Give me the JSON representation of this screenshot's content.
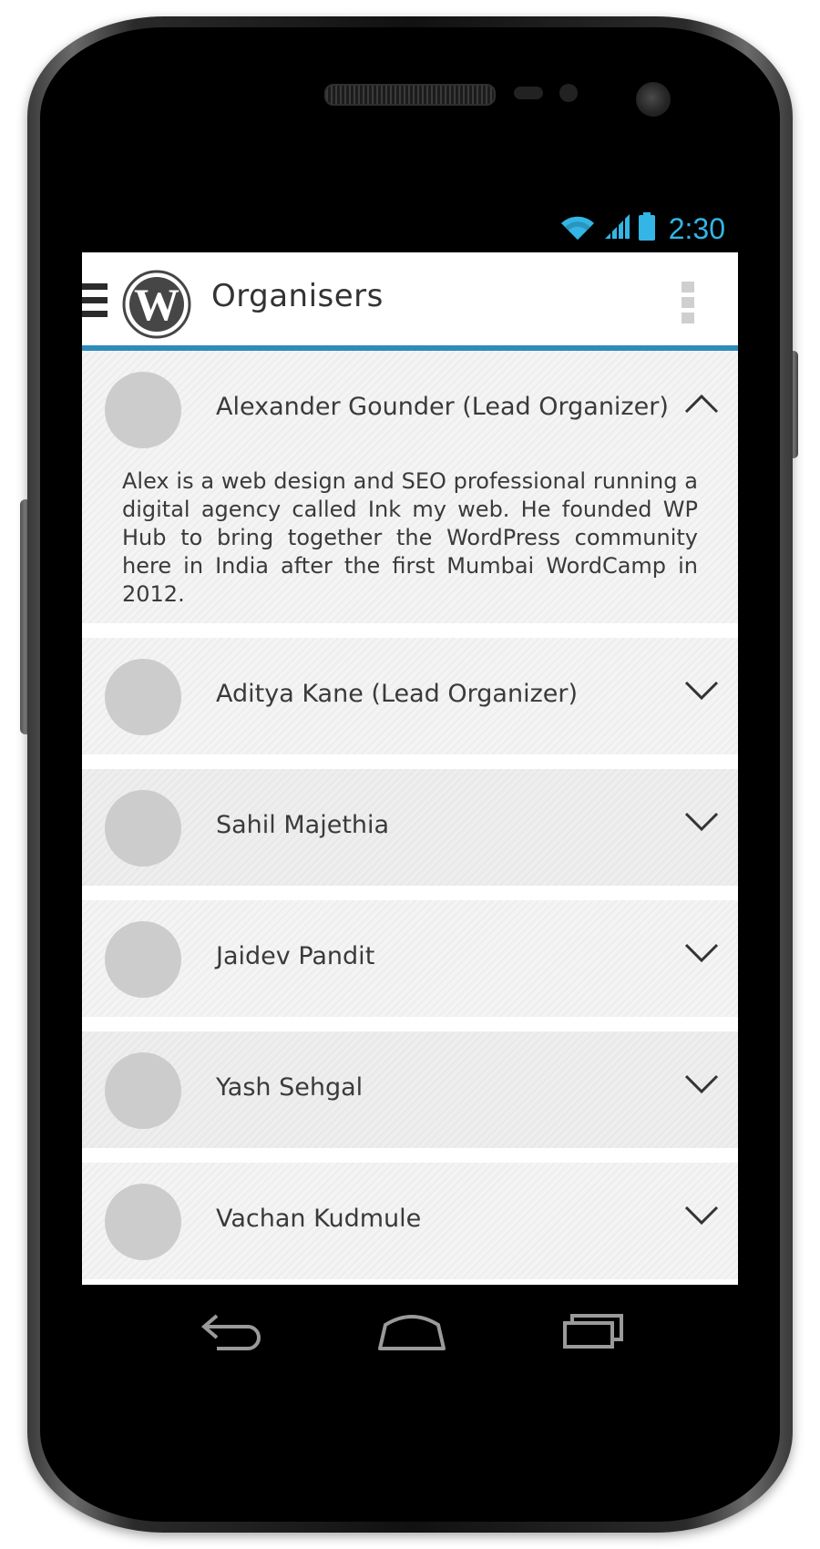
{
  "status_bar": {
    "time": "2:30",
    "icons": [
      "wifi-icon",
      "signal-icon",
      "battery-icon"
    ],
    "accent_color": "#33b5e5"
  },
  "action_bar": {
    "title": "Organisers",
    "logo": "wordpress-logo",
    "menu_icon": "hamburger-menu-icon",
    "overflow_icon": "overflow-menu-icon",
    "divider_color": "#2d8cbd"
  },
  "organizers": [
    {
      "name": "Alexander Gounder (Lead Organizer)",
      "expanded": true,
      "description": "Alex is a web design and SEO professional running a digital agency called Ink my web. He founded WP Hub to bring together the WordPress community here in India after the first Mumbai WordCamp in 2012."
    },
    {
      "name": "Aditya Kane (Lead Organizer)",
      "expanded": false
    },
    {
      "name": "Sahil Majethia",
      "expanded": false
    },
    {
      "name": "Jaidev Pandit",
      "expanded": false
    },
    {
      "name": "Yash Sehgal",
      "expanded": false
    },
    {
      "name": "Vachan Kudmule",
      "expanded": false
    }
  ],
  "navigation": [
    "back-icon",
    "home-icon",
    "recent-apps-icon"
  ]
}
